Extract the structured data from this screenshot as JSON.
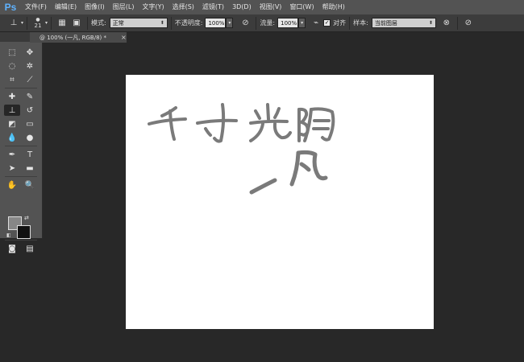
{
  "app": {
    "logo": "Ps"
  },
  "menu": [
    "文件(F)",
    "编辑(E)",
    "图像(I)",
    "图层(L)",
    "文字(Y)",
    "选择(S)",
    "滤镜(T)",
    "3D(D)",
    "视图(V)",
    "窗口(W)",
    "帮助(H)"
  ],
  "options": {
    "brush_size": "21",
    "mode_label": "模式:",
    "mode_value": "正常",
    "opacity_label": "不透明度:",
    "opacity_value": "100%",
    "flow_label": "流量:",
    "flow_value": "100%",
    "aligned_label": "对齐",
    "aligned_checked": "✓",
    "sample_label": "样本:",
    "sample_value": "当前图层"
  },
  "document": {
    "tab_close": "×",
    "tab_title": "@ 100% (一凡, RGB/8) *"
  },
  "toolbox": {
    "collapse": "◂◂",
    "foreground_color": "#878787",
    "background_color": "#111111"
  },
  "canvas": {
    "strokes_color": "#7a7a7a",
    "line1": "千寸光阴",
    "line2": "一凡"
  }
}
